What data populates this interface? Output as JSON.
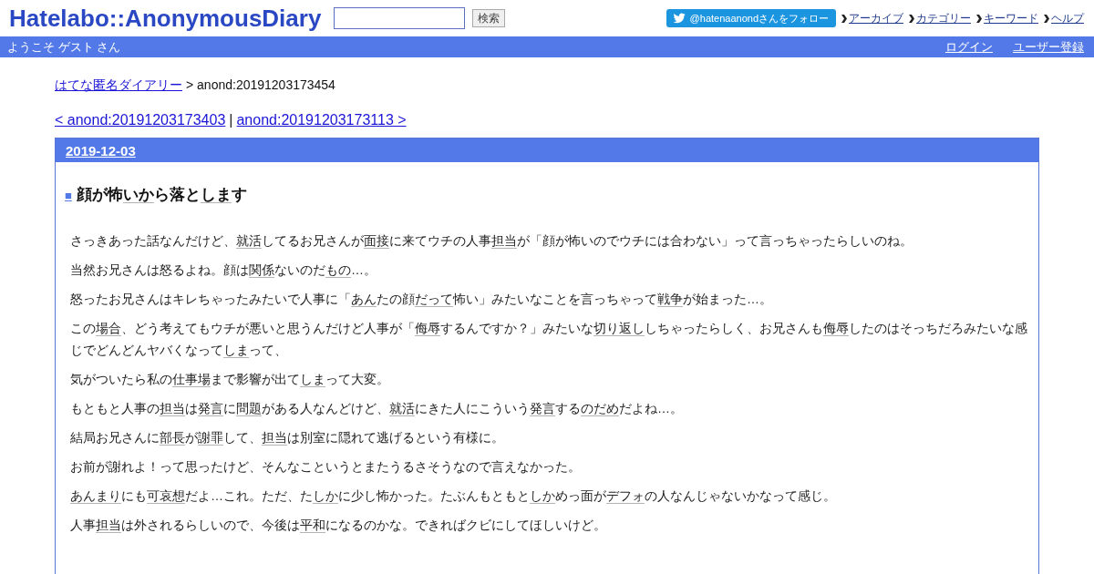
{
  "header": {
    "logo": "Hatelabo::AnonymousDiary",
    "search": {
      "button": "検索"
    },
    "follow_button": "@hatenaanondさんをフォロー",
    "nav_links": [
      "アーカイブ",
      "カテゴリー",
      "キーワード",
      "ヘルプ"
    ]
  },
  "user_bar": {
    "greeting": "ようこそ ゲスト さん",
    "links": [
      "ログイン",
      "ユーザー登録"
    ]
  },
  "breadcrumb": {
    "link": "はてな匿名ダイアリー",
    "current": "> anond:20191203173454"
  },
  "pager": {
    "prev": "< anond:20191203173403",
    "separator": "|",
    "next": "anond:20191203173113 >"
  },
  "entry": {
    "date": "2019-12-03",
    "title_mark": "■",
    "title": [
      {
        "kind": "text",
        "text": "顔が怖"
      },
      {
        "kind": "keyword",
        "text": "いか"
      },
      {
        "kind": "text",
        "text": "ら落と"
      },
      {
        "kind": "keyword",
        "text": "しま"
      },
      {
        "kind": "text",
        "text": "す"
      }
    ],
    "paragraphs": [
      [
        {
          "kind": "text",
          "text": "さっきあった話なんだけど、"
        },
        {
          "kind": "keyword",
          "text": "就活"
        },
        {
          "kind": "text",
          "text": "してるお兄さんが"
        },
        {
          "kind": "keyword",
          "text": "面接"
        },
        {
          "kind": "text",
          "text": "に来てウチの人事"
        },
        {
          "kind": "keyword",
          "text": "担当"
        },
        {
          "kind": "text",
          "text": "が「顔が怖いのでウチには合わない」って言っちゃったらしいのね。"
        }
      ],
      [
        {
          "kind": "text",
          "text": "当然お兄さんは怒るよね。顔は"
        },
        {
          "kind": "keyword",
          "text": "関係"
        },
        {
          "kind": "text",
          "text": "ないのだ"
        },
        {
          "kind": "keyword",
          "text": "もの"
        },
        {
          "kind": "text",
          "text": "…。"
        }
      ],
      [
        {
          "kind": "text",
          "text": "怒ったお兄さんはキレちゃったみたいで人事に「"
        },
        {
          "kind": "keyword",
          "text": "あん"
        },
        {
          "kind": "text",
          "text": "たの顔"
        },
        {
          "kind": "keyword",
          "text": "だって"
        },
        {
          "kind": "text",
          "text": "怖い」みたいなことを言っちゃって"
        },
        {
          "kind": "keyword",
          "text": "戦争"
        },
        {
          "kind": "text",
          "text": "が始まった…。"
        }
      ],
      [
        {
          "kind": "text",
          "text": "この"
        },
        {
          "kind": "keyword",
          "text": "場合"
        },
        {
          "kind": "text",
          "text": "、どう考えてもウチが悪いと思うんだけど人事が「"
        },
        {
          "kind": "keyword",
          "text": "侮辱"
        },
        {
          "kind": "text",
          "text": "するんですか？」みたいな"
        },
        {
          "kind": "keyword",
          "text": "切り返し"
        },
        {
          "kind": "text",
          "text": "しちゃったらしく、お兄さんも"
        },
        {
          "kind": "keyword",
          "text": "侮辱"
        },
        {
          "kind": "text",
          "text": "したのはそっちだろみたいな感じでどんどんヤバくなって"
        },
        {
          "kind": "keyword",
          "text": "しま"
        },
        {
          "kind": "text",
          "text": "って、"
        }
      ],
      [
        {
          "kind": "text",
          "text": "気がついたら私の"
        },
        {
          "kind": "keyword",
          "text": "仕事場"
        },
        {
          "kind": "text",
          "text": "まで影響が出て"
        },
        {
          "kind": "keyword",
          "text": "しま"
        },
        {
          "kind": "text",
          "text": "って大変。"
        }
      ],
      [
        {
          "kind": "text",
          "text": "もともと人事の"
        },
        {
          "kind": "keyword",
          "text": "担当"
        },
        {
          "kind": "text",
          "text": "は"
        },
        {
          "kind": "keyword",
          "text": "発言"
        },
        {
          "kind": "text",
          "text": "に"
        },
        {
          "kind": "keyword",
          "text": "問題"
        },
        {
          "kind": "text",
          "text": "がある人なんどけど、"
        },
        {
          "kind": "keyword",
          "text": "就活"
        },
        {
          "kind": "text",
          "text": "にきた人にこういう"
        },
        {
          "kind": "keyword",
          "text": "発言"
        },
        {
          "kind": "text",
          "text": "する"
        },
        {
          "kind": "keyword",
          "text": "のだめ"
        },
        {
          "kind": "text",
          "text": "だよね…。"
        }
      ],
      [
        {
          "kind": "text",
          "text": "結局お兄さんに"
        },
        {
          "kind": "keyword",
          "text": "部長"
        },
        {
          "kind": "text",
          "text": "が"
        },
        {
          "kind": "keyword",
          "text": "謝罪"
        },
        {
          "kind": "text",
          "text": "して、"
        },
        {
          "kind": "keyword",
          "text": "担当"
        },
        {
          "kind": "text",
          "text": "は別室に隠れて逃げるという有様に。"
        }
      ],
      [
        {
          "kind": "text",
          "text": "お前が謝れよ！って思ったけど、そんなこというとまたうるさそうなので言えなかった。"
        }
      ],
      [
        {
          "kind": "keyword",
          "text": "あんまり"
        },
        {
          "kind": "text",
          "text": "にも"
        },
        {
          "kind": "keyword",
          "text": "可哀想"
        },
        {
          "kind": "text",
          "text": "だよ…これ。ただ、た"
        },
        {
          "kind": "keyword",
          "text": "しか"
        },
        {
          "kind": "text",
          "text": "に少し怖かった。たぶんもともと"
        },
        {
          "kind": "keyword",
          "text": "しか"
        },
        {
          "kind": "text",
          "text": "めっ面が"
        },
        {
          "kind": "keyword",
          "text": "デフォ"
        },
        {
          "kind": "text",
          "text": "の人なんじゃないかなって感じ。"
        }
      ],
      [
        {
          "kind": "text",
          "text": "人事"
        },
        {
          "kind": "keyword",
          "text": "担当"
        },
        {
          "kind": "text",
          "text": "は外されるらしいので、今後は"
        },
        {
          "kind": "keyword",
          "text": "平和"
        },
        {
          "kind": "text",
          "text": "になるのかな。できればクビにしてほしいけど。"
        }
      ]
    ]
  }
}
